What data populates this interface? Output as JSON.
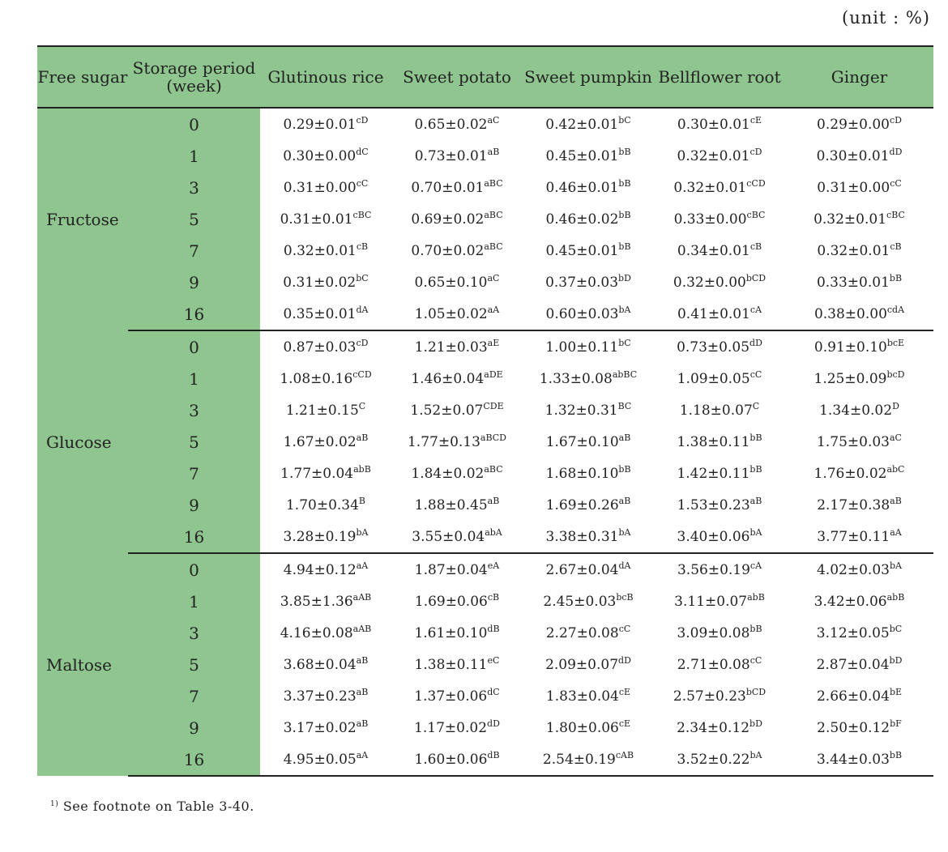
{
  "unit_label": "(unit : %)",
  "headers": {
    "free_sugar": "Free sugar",
    "storage_period": "Storage period (week)",
    "columns": [
      "Glutinous rice",
      "Sweet potato",
      "Sweet pumpkin",
      "Bellflower root",
      "Ginger"
    ]
  },
  "groups": [
    {
      "sugar": "Fructose",
      "rows": [
        {
          "week": "0",
          "cells": [
            {
              "v": "0.29±0.01",
              "s": "cD"
            },
            {
              "v": "0.65±0.02",
              "s": "aC"
            },
            {
              "v": "0.42±0.01",
              "s": "bC"
            },
            {
              "v": "0.30±0.01",
              "s": "cE"
            },
            {
              "v": "0.29±0.00",
              "s": "cD"
            }
          ]
        },
        {
          "week": "1",
          "cells": [
            {
              "v": "0.30±0.00",
              "s": "dC"
            },
            {
              "v": "0.73±0.01",
              "s": "aB"
            },
            {
              "v": "0.45±0.01",
              "s": "bB"
            },
            {
              "v": "0.32±0.01",
              "s": "cD"
            },
            {
              "v": "0.30±0.01",
              "s": "dD"
            }
          ]
        },
        {
          "week": "3",
          "cells": [
            {
              "v": "0.31±0.00",
              "s": "cC"
            },
            {
              "v": "0.70±0.01",
              "s": "aBC"
            },
            {
              "v": "0.46±0.01",
              "s": "bB"
            },
            {
              "v": "0.32±0.01",
              "s": "cCD"
            },
            {
              "v": "0.31±0.00",
              "s": "cC"
            }
          ]
        },
        {
          "week": "5",
          "cells": [
            {
              "v": "0.31±0.01",
              "s": "cBC"
            },
            {
              "v": "0.69±0.02",
              "s": "aBC"
            },
            {
              "v": "0.46±0.02",
              "s": "bB"
            },
            {
              "v": "0.33±0.00",
              "s": "cBC"
            },
            {
              "v": "0.32±0.01",
              "s": "cBC"
            }
          ]
        },
        {
          "week": "7",
          "cells": [
            {
              "v": "0.32±0.01",
              "s": "cB"
            },
            {
              "v": "0.70±0.02",
              "s": "aBC"
            },
            {
              "v": "0.45±0.01",
              "s": "bB"
            },
            {
              "v": "0.34±0.01",
              "s": "cB"
            },
            {
              "v": "0.32±0.01",
              "s": "cB"
            }
          ]
        },
        {
          "week": "9",
          "cells": [
            {
              "v": "0.31±0.02",
              "s": "bC"
            },
            {
              "v": "0.65±0.10",
              "s": "aC"
            },
            {
              "v": "0.37±0.03",
              "s": "bD"
            },
            {
              "v": "0.32±0.00",
              "s": "bCD"
            },
            {
              "v": "0.33±0.01",
              "s": "bB"
            }
          ]
        },
        {
          "week": "16",
          "cells": [
            {
              "v": "0.35±0.01",
              "s": "dA"
            },
            {
              "v": "1.05±0.02",
              "s": "aA"
            },
            {
              "v": "0.60±0.03",
              "s": "bA"
            },
            {
              "v": "0.41±0.01",
              "s": "cA"
            },
            {
              "v": "0.38±0.00",
              "s": "cdA"
            }
          ]
        }
      ]
    },
    {
      "sugar": "Glucose",
      "rows": [
        {
          "week": "0",
          "cells": [
            {
              "v": "0.87±0.03",
              "s": "cD"
            },
            {
              "v": "1.21±0.03",
              "s": "aE"
            },
            {
              "v": "1.00±0.11",
              "s": "bC"
            },
            {
              "v": "0.73±0.05",
              "s": "dD"
            },
            {
              "v": "0.91±0.10",
              "s": "bcE"
            }
          ]
        },
        {
          "week": "1",
          "cells": [
            {
              "v": "1.08±0.16",
              "s": "cCD"
            },
            {
              "v": "1.46±0.04",
              "s": "aDE"
            },
            {
              "v": "1.33±0.08",
              "s": "abBC"
            },
            {
              "v": "1.09±0.05",
              "s": "cC"
            },
            {
              "v": "1.25±0.09",
              "s": "bcD"
            }
          ]
        },
        {
          "week": "3",
          "cells": [
            {
              "v": "1.21±0.15",
              "s": "C"
            },
            {
              "v": "1.52±0.07",
              "s": "CDE"
            },
            {
              "v": "1.32±0.31",
              "s": "BC"
            },
            {
              "v": "1.18±0.07",
              "s": "C"
            },
            {
              "v": "1.34±0.02",
              "s": "D"
            }
          ]
        },
        {
          "week": "5",
          "cells": [
            {
              "v": "1.67±0.02",
              "s": "aB"
            },
            {
              "v": "1.77±0.13",
              "s": "aBCD"
            },
            {
              "v": "1.67±0.10",
              "s": "aB"
            },
            {
              "v": "1.38±0.11",
              "s": "bB"
            },
            {
              "v": "1.75±0.03",
              "s": "aC"
            }
          ]
        },
        {
          "week": "7",
          "cells": [
            {
              "v": "1.77±0.04",
              "s": "abB"
            },
            {
              "v": "1.84±0.02",
              "s": "aBC"
            },
            {
              "v": "1.68±0.10",
              "s": "bB"
            },
            {
              "v": "1.42±0.11",
              "s": "bB"
            },
            {
              "v": "1.76±0.02",
              "s": "abC"
            }
          ]
        },
        {
          "week": "9",
          "cells": [
            {
              "v": "1.70±0.34",
              "s": "B"
            },
            {
              "v": "1.88±0.45",
              "s": "aB"
            },
            {
              "v": "1.69±0.26",
              "s": "aB"
            },
            {
              "v": "1.53±0.23",
              "s": "aB"
            },
            {
              "v": "2.17±0.38",
              "s": "aB"
            }
          ]
        },
        {
          "week": "16",
          "cells": [
            {
              "v": "3.28±0.19",
              "s": "bA"
            },
            {
              "v": "3.55±0.04",
              "s": "abA"
            },
            {
              "v": "3.38±0.31",
              "s": "bA"
            },
            {
              "v": "3.40±0.06",
              "s": "bA"
            },
            {
              "v": "3.77±0.11",
              "s": "aA"
            }
          ]
        }
      ]
    },
    {
      "sugar": "Maltose",
      "rows": [
        {
          "week": "0",
          "cells": [
            {
              "v": "4.94±0.12",
              "s": "aA"
            },
            {
              "v": "1.87±0.04",
              "s": "eA"
            },
            {
              "v": "2.67±0.04",
              "s": "dA"
            },
            {
              "v": "3.56±0.19",
              "s": "cA"
            },
            {
              "v": "4.02±0.03",
              "s": "bA"
            }
          ]
        },
        {
          "week": "1",
          "cells": [
            {
              "v": "3.85±1.36",
              "s": "aAB"
            },
            {
              "v": "1.69±0.06",
              "s": "cB"
            },
            {
              "v": "2.45±0.03",
              "s": "bcB"
            },
            {
              "v": "3.11±0.07",
              "s": "abB"
            },
            {
              "v": "3.42±0.06",
              "s": "abB"
            }
          ]
        },
        {
          "week": "3",
          "cells": [
            {
              "v": "4.16±0.08",
              "s": "aAB"
            },
            {
              "v": "1.61±0.10",
              "s": "dB"
            },
            {
              "v": "2.27±0.08",
              "s": "cC"
            },
            {
              "v": "3.09±0.08",
              "s": "bB"
            },
            {
              "v": "3.12±0.05",
              "s": "bC"
            }
          ]
        },
        {
          "week": "5",
          "cells": [
            {
              "v": "3.68±0.04",
              "s": "aB"
            },
            {
              "v": "1.38±0.11",
              "s": "eC"
            },
            {
              "v": "2.09±0.07",
              "s": "dD"
            },
            {
              "v": "2.71±0.08",
              "s": "cC"
            },
            {
              "v": "2.87±0.04",
              "s": "bD"
            }
          ]
        },
        {
          "week": "7",
          "cells": [
            {
              "v": "3.37±0.23",
              "s": "aB"
            },
            {
              "v": "1.37±0.06",
              "s": "dC"
            },
            {
              "v": "1.83±0.04",
              "s": "cE"
            },
            {
              "v": "2.57±0.23",
              "s": "bCD"
            },
            {
              "v": "2.66±0.04",
              "s": "bE"
            }
          ]
        },
        {
          "week": "9",
          "cells": [
            {
              "v": "3.17±0.02",
              "s": "aB"
            },
            {
              "v": "1.17±0.02",
              "s": "dD"
            },
            {
              "v": "1.80±0.06",
              "s": "cE"
            },
            {
              "v": "2.34±0.12",
              "s": "bD"
            },
            {
              "v": "2.50±0.12",
              "s": "bF"
            }
          ]
        },
        {
          "week": "16",
          "cells": [
            {
              "v": "4.95±0.05",
              "s": "aA"
            },
            {
              "v": "1.60±0.06",
              "s": "dB"
            },
            {
              "v": "2.54±0.19",
              "s": "cAB"
            },
            {
              "v": "3.52±0.22",
              "s": "bA"
            },
            {
              "v": "3.44±0.03",
              "s": "bB"
            }
          ]
        }
      ]
    }
  ],
  "footnote": {
    "marker": "1)",
    "text": "See footnote on Table 3-40."
  }
}
